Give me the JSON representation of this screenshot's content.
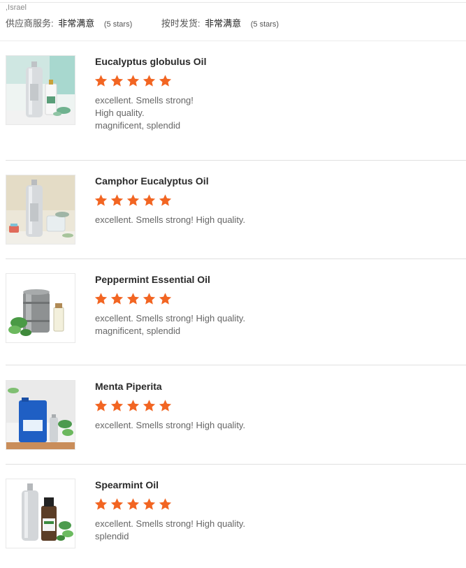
{
  "header": {
    "location": ",Israel",
    "supplier_service": {
      "label": "供应商服务:",
      "value": "非常满意",
      "stars_text": "(5 stars)"
    },
    "on_time_delivery": {
      "label": "按时发货:",
      "value": "非常满意",
      "stars_text": "(5 stars)"
    }
  },
  "colors": {
    "star": "#f26522",
    "divider": "#e0e0e0",
    "comment_text": "#666666"
  },
  "reviews": [
    {
      "product_name": "Eucalyptus globulus Oil",
      "rating": 5,
      "max_rating": 5,
      "comments": [
        "excellent. Smells strong!",
        "High quality.",
        "magnificent, splendid"
      ],
      "image_icon": "eucalyptus-oil-bottle-image"
    },
    {
      "product_name": "Camphor Eucalyptus Oil",
      "rating": 5,
      "max_rating": 5,
      "comments": [
        "excellent. Smells strong! High quality."
      ],
      "image_icon": "camphor-oil-bottle-image"
    },
    {
      "product_name": "Peppermint Essential Oil",
      "rating": 5,
      "max_rating": 5,
      "comments": [
        "excellent. Smells strong! High quality.",
        "magnificent, splendid"
      ],
      "image_icon": "peppermint-oil-drum-image"
    },
    {
      "product_name": "Menta Piperita",
      "rating": 5,
      "max_rating": 5,
      "comments": [
        "excellent. Smells strong! High quality."
      ],
      "image_icon": "menta-piperita-container-image"
    },
    {
      "product_name": "Spearmint Oil",
      "rating": 5,
      "max_rating": 5,
      "comments": [
        "excellent. Smells strong! High quality.",
        "splendid"
      ],
      "image_icon": "spearmint-oil-bottle-image"
    }
  ]
}
